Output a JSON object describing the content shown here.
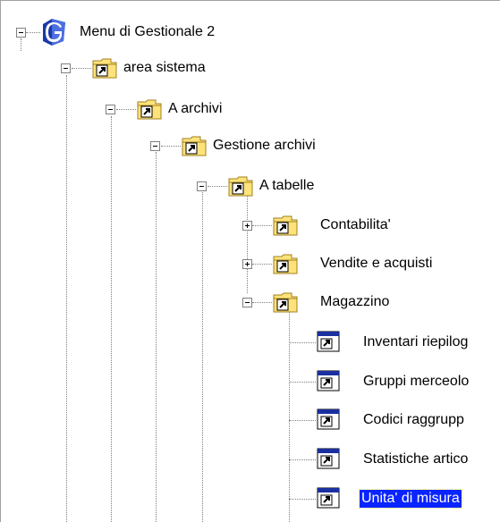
{
  "tree": {
    "root": {
      "label": "Menu di Gestionale 2",
      "icon": "app-logo-icon",
      "expanded": true
    },
    "nodes": [
      {
        "label": "area sistema",
        "icon": "folder-shortcut-icon",
        "expanded": true
      },
      {
        "label": "A archivi",
        "icon": "folder-shortcut-icon",
        "expanded": true
      },
      {
        "label": "Gestione archivi",
        "icon": "folder-shortcut-icon",
        "expanded": true
      },
      {
        "label": "A tabelle",
        "icon": "folder-shortcut-icon",
        "expanded": true
      },
      {
        "label": "Contabilita'",
        "icon": "folder-shortcut-icon",
        "expanded": false
      },
      {
        "label": "Vendite e acquisti",
        "icon": "folder-shortcut-icon",
        "expanded": false
      },
      {
        "label": "Magazzino",
        "icon": "folder-shortcut-icon",
        "expanded": true
      },
      {
        "label": "Inventari riepilog",
        "icon": "program-window-shortcut-icon"
      },
      {
        "label": "Gruppi merceolo",
        "icon": "program-window-shortcut-icon"
      },
      {
        "label": "Codici raggrupp",
        "icon": "program-window-shortcut-icon"
      },
      {
        "label": "Statistiche artico",
        "icon": "program-window-shortcut-icon"
      },
      {
        "label": "Unita' di misura",
        "icon": "program-window-shortcut-icon",
        "selected": true
      }
    ]
  },
  "colors": {
    "selection_bg": "#0a24ff",
    "selection_text": "#ffffff",
    "folder_fill": "#ffe37a",
    "folder_dark": "#a08020",
    "logo_blue": "#1a3aa8"
  }
}
